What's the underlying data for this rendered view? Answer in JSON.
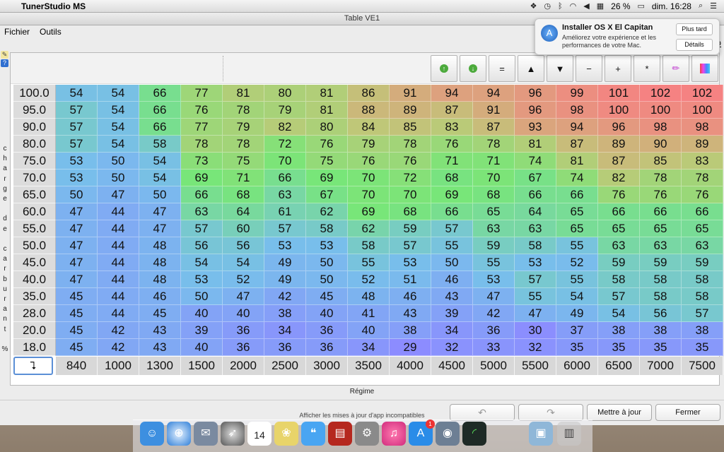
{
  "menubar": {
    "app_name": "TunerStudio MS",
    "battery": "26 %",
    "clock": "dim. 16:28"
  },
  "window": {
    "title": "Table VE1",
    "menu": [
      "Fichier",
      "Outils"
    ],
    "edge_letter": "D"
  },
  "notification": {
    "title": "Installer OS X El Capitan",
    "body": "Améliorez votre expérience et les performances de votre Mac.",
    "later_label": "Plus tard",
    "details_label": "Détails"
  },
  "toolbar": {
    "buttons": [
      "up-arrow",
      "down-arrow",
      "=",
      "▲",
      "▼",
      "−",
      "+",
      "*",
      "pen",
      "palette"
    ],
    "labels": {
      "eq": "=",
      "up": "▲",
      "down": "▼",
      "minus": "−",
      "plus": "+",
      "mult": "*"
    }
  },
  "table": {
    "y_axis_label": "charge de carburant %",
    "x_axis_label": "Régime",
    "y_bins": [
      "100.0",
      "95.0",
      "90.0",
      "80.0",
      "75.0",
      "70.0",
      "65.0",
      "60.0",
      "55.0",
      "50.0",
      "45.0",
      "40.0",
      "35.0",
      "28.0",
      "20.0",
      "18.0"
    ],
    "x_bins": [
      "840",
      "1000",
      "1300",
      "1500",
      "2000",
      "2500",
      "3000",
      "3500",
      "4000",
      "4500",
      "5000",
      "5500",
      "6000",
      "6500",
      "7000",
      "7500"
    ],
    "rows": [
      [
        54,
        54,
        66,
        77,
        81,
        80,
        81,
        86,
        91,
        94,
        94,
        96,
        99,
        101,
        102,
        102
      ],
      [
        57,
        54,
        66,
        76,
        78,
        79,
        81,
        88,
        89,
        87,
        91,
        96,
        98,
        100,
        100,
        100
      ],
      [
        57,
        54,
        66,
        77,
        79,
        82,
        80,
        84,
        85,
        83,
        87,
        93,
        94,
        96,
        98,
        98
      ],
      [
        57,
        54,
        58,
        78,
        78,
        72,
        76,
        79,
        78,
        76,
        78,
        81,
        87,
        89,
        90,
        89
      ],
      [
        53,
        50,
        54,
        73,
        75,
        70,
        75,
        76,
        76,
        71,
        71,
        74,
        81,
        87,
        85,
        83
      ],
      [
        53,
        50,
        54,
        69,
        71,
        66,
        69,
        70,
        72,
        68,
        70,
        67,
        74,
        82,
        78,
        78
      ],
      [
        50,
        47,
        50,
        66,
        68,
        63,
        67,
        70,
        70,
        69,
        68,
        66,
        66,
        76,
        76,
        76
      ],
      [
        47,
        44,
        47,
        63,
        64,
        61,
        62,
        69,
        68,
        66,
        65,
        64,
        65,
        66,
        66,
        66
      ],
      [
        47,
        44,
        47,
        57,
        60,
        57,
        58,
        62,
        59,
        57,
        63,
        63,
        65,
        65,
        65,
        65
      ],
      [
        47,
        44,
        48,
        56,
        56,
        53,
        53,
        58,
        57,
        55,
        59,
        58,
        55,
        63,
        63,
        63
      ],
      [
        47,
        44,
        48,
        54,
        54,
        49,
        50,
        55,
        53,
        50,
        55,
        53,
        52,
        59,
        59,
        59
      ],
      [
        47,
        44,
        48,
        53,
        52,
        49,
        50,
        52,
        51,
        46,
        53,
        57,
        55,
        58,
        58,
        58
      ],
      [
        45,
        44,
        46,
        50,
        47,
        42,
        45,
        48,
        46,
        43,
        47,
        55,
        54,
        57,
        58,
        58
      ],
      [
        45,
        44,
        45,
        40,
        40,
        38,
        40,
        41,
        43,
        39,
        42,
        47,
        49,
        54,
        56,
        57
      ],
      [
        45,
        42,
        43,
        39,
        36,
        34,
        36,
        40,
        38,
        34,
        36,
        30,
        37,
        38,
        38,
        38
      ],
      [
        45,
        42,
        43,
        40,
        36,
        36,
        36,
        34,
        29,
        32,
        33,
        32,
        35,
        35,
        35,
        35
      ]
    ],
    "corner_symbol": "⮧"
  },
  "footer": {
    "update_label": "Mettre à jour",
    "close_label": "Fermer"
  },
  "dock": {
    "hint_text": "Afficher les mises à jour d'app incompatibles",
    "calendar_day": "14",
    "app_store_badge": "1"
  }
}
